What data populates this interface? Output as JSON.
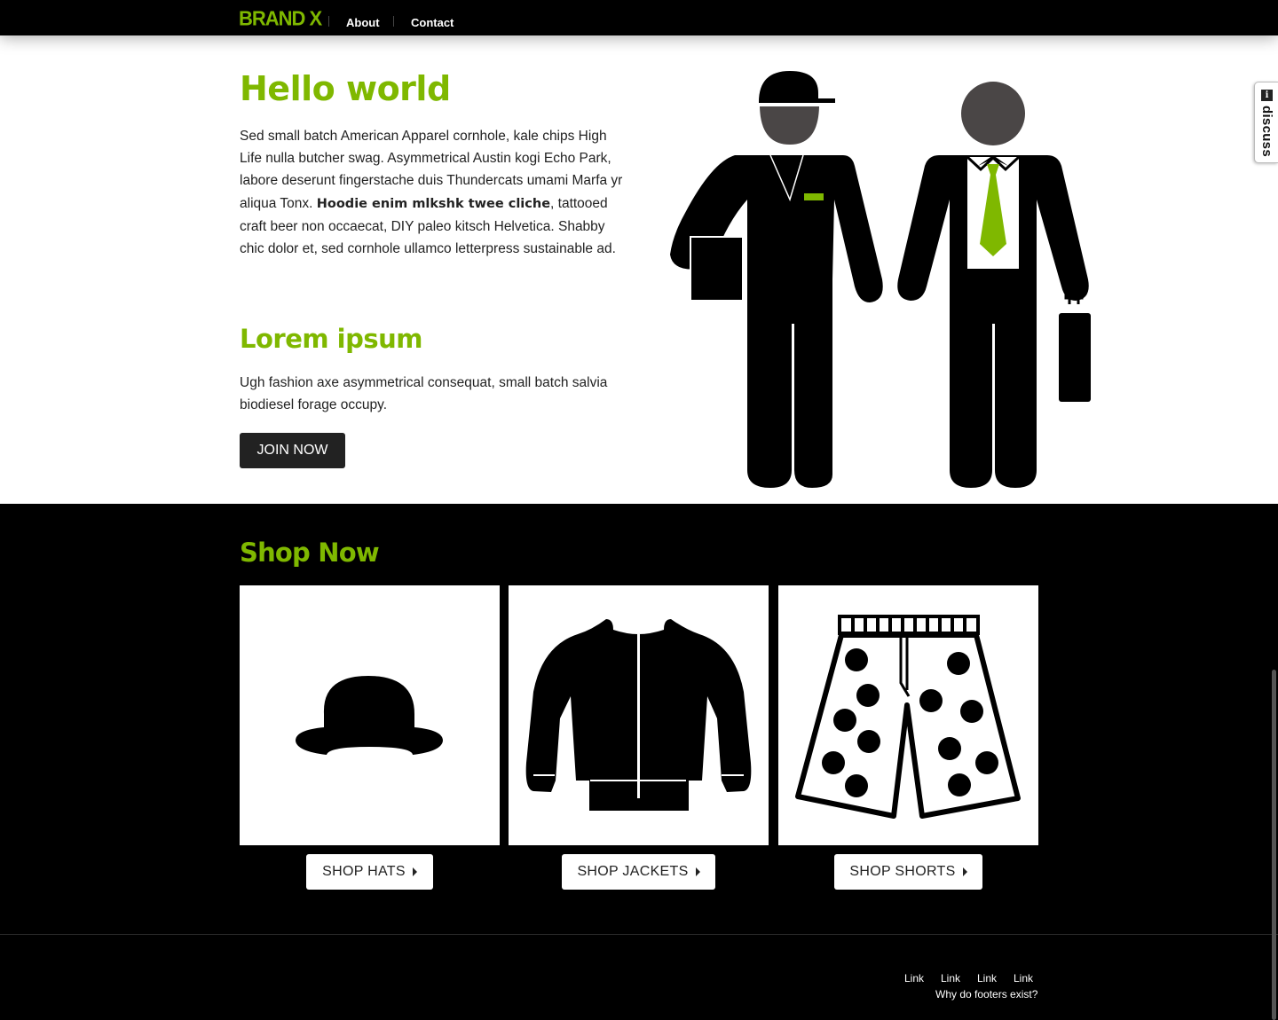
{
  "nav": {
    "brand": "BRAND X",
    "links": [
      "About",
      "Contact"
    ]
  },
  "hero": {
    "title": "Hello world",
    "paragraph_before_bold": "Sed small batch American Apparel cornhole, kale chips High Life nulla butcher swag. Asymmetrical Austin kogi Echo Park, labore deserunt fingerstache duis Thundercats umami Marfa yr aliqua Tonx. ",
    "paragraph_bold": "Hoodie enim mlkshk twee cliche",
    "paragraph_after_bold": ", tattooed craft beer non occaecat, DIY paleo kitsch Helvetica. Shabby chic dolor et, sed cornhole ullamco letterpress sustainable ad.",
    "subtitle": "Lorem ipsum",
    "subparagraph": "Ugh fashion axe asymmetrical consequat, small batch salvia biodiesel forage occupy.",
    "join_label": "JOIN NOW"
  },
  "discuss": {
    "label": "discuss",
    "info": "i"
  },
  "shop": {
    "title": "Shop Now",
    "items": [
      {
        "label": "SHOP HATS",
        "icon": "bowler-hat-icon"
      },
      {
        "label": "SHOP JACKETS",
        "icon": "jacket-icon"
      },
      {
        "label": "SHOP SHORTS",
        "icon": "shorts-icon"
      }
    ]
  },
  "footer": {
    "links": [
      "Link",
      "Link",
      "Link",
      "Link"
    ],
    "text": "Why do footers exist?"
  },
  "colors": {
    "accent": "#7fb800",
    "dark": "#000000",
    "button_dark": "#222222"
  }
}
